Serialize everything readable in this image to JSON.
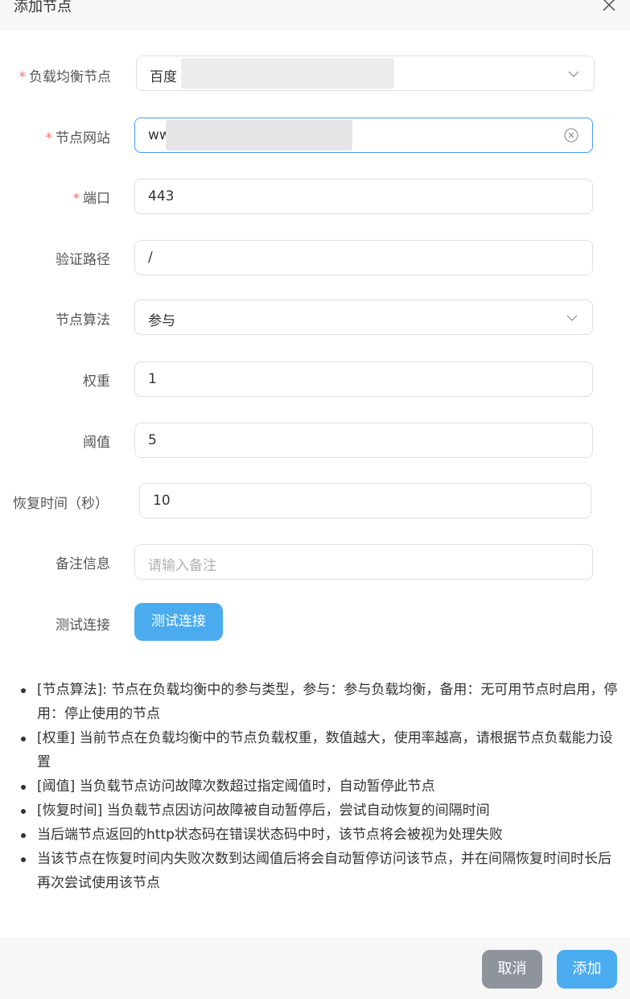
{
  "dialog": {
    "title": "添加节点"
  },
  "form": {
    "lb_group": {
      "label": "负载均衡节点",
      "value": "百度",
      "required": "*"
    },
    "site": {
      "label": "节点网站",
      "value": "ww",
      "required": "*"
    },
    "port": {
      "label": "端口",
      "value": "443",
      "required": "*"
    },
    "path": {
      "label": "验证路径",
      "value": "/"
    },
    "algorithm": {
      "label": "节点算法",
      "value": "参与"
    },
    "weight": {
      "label": "权重",
      "value": "1"
    },
    "threshold": {
      "label": "阈值",
      "value": "5"
    },
    "recovery": {
      "label": "恢复时间（秒）",
      "value": "10"
    },
    "remark": {
      "label": "备注信息",
      "placeholder": "请输入备注"
    },
    "test": {
      "label": "测试连接",
      "button": "测试连接"
    }
  },
  "tips": [
    "[节点算法]: 节点在负载均衡中的参与类型，参与：参与负载均衡，备用：无可用节点时启用，停用：停止使用的节点",
    "[权重] 当前节点在负载均衡中的节点负载权重，数值越大，使用率越高，请根据节点负载能力设置",
    "[阈值] 当负载节点访问故障次数超过指定阈值时，自动暂停此节点",
    "[恢复时间] 当负载节点因访问故障被自动暂停后，尝试自动恢复的间隔时间",
    "当后端节点返回的http状态码在错误状态码中时，该节点将会被视为处理失败",
    "当该节点在恢复时间内失败次数到达阈值后将会自动暂停访问该节点，并在间隔恢复时间时长后再次尝试使用该节点"
  ],
  "footer": {
    "cancel": "取消",
    "add": "添加"
  }
}
